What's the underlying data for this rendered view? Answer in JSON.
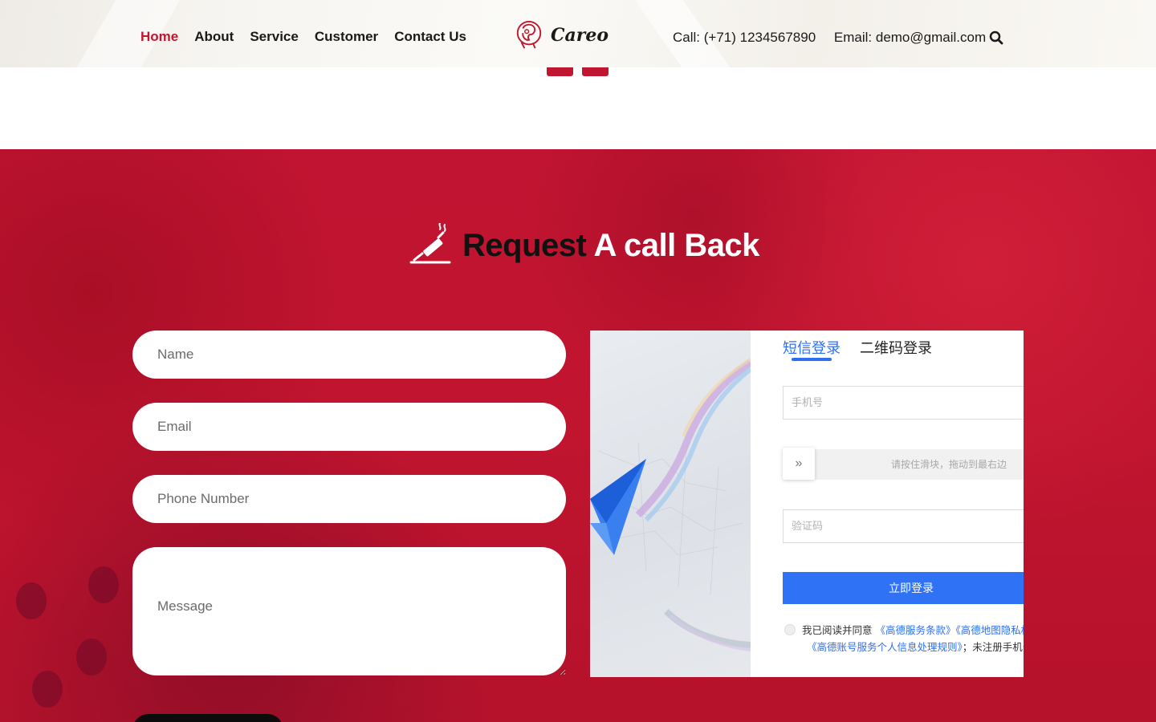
{
  "header": {
    "nav": [
      {
        "label": "Home",
        "active": true
      },
      {
        "label": "About",
        "active": false
      },
      {
        "label": "Service",
        "active": false
      },
      {
        "label": "Customer",
        "active": false
      },
      {
        "label": "Contact Us",
        "active": false
      }
    ],
    "logo_text": "Careo",
    "call": "Call: (+71) 1234567890",
    "email": "Email: demo@gmail.com",
    "search_icon": "search-icon"
  },
  "callback": {
    "title_dark": "Request",
    "title_light": "A call Back",
    "icon": "syringe-icon",
    "fields": {
      "name_placeholder": "Name",
      "email_placeholder": "Email",
      "phone_placeholder": "Phone Number",
      "message_placeholder": "Message"
    }
  },
  "login_widget": {
    "tab_sms": "短信登录",
    "tab_qr": "二维码登录",
    "phone_placeholder": "手机号",
    "slider_hint": "请按住滑块，拖动到最右边",
    "slider_handle": "»",
    "code_placeholder": "验证码",
    "login_button": "立即登录",
    "agree_prefix": "我已阅读并同意",
    "link_terms": "《高德服务条款》",
    "link_map": "《高德地图隐私权政策》",
    "link_privacy": "《高德账号服务个人信息处理规则》",
    "agree_suffix": "；未注册手机号验证后将自动创建账号"
  },
  "colors": {
    "brand_red": "#c0162f",
    "login_blue": "#2f72f6"
  }
}
